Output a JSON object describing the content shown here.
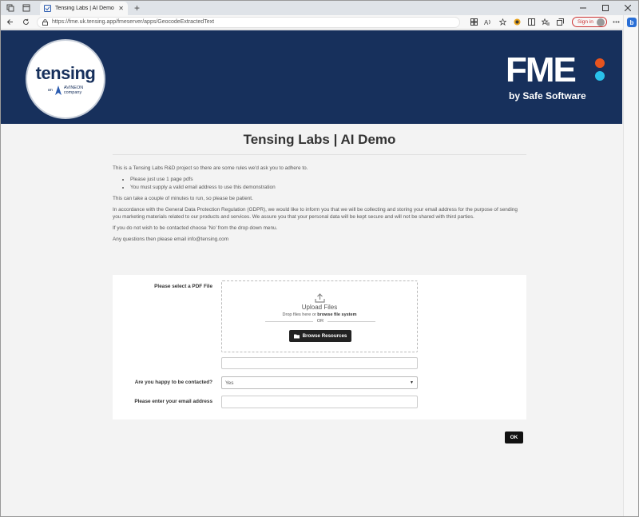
{
  "browser": {
    "tab_title": "Tensing Labs | AI Demo",
    "url": "https://fme.uk.tensing.app/fmeserver/apps/GeocodeExtractedText",
    "signin_label": "Sign in",
    "new_tab": "+",
    "close_tab": "✕"
  },
  "banner": {
    "logo_word": "tensing",
    "logo_an": "an",
    "logo_company_name": "AVINEON",
    "logo_company": "company",
    "fme_word": "FME",
    "fme_by": "by Safe Software"
  },
  "page": {
    "title": "Tensing Labs | AI Demo",
    "intro_1": "This is a Tensing Labs R&D project so there are some rules we'd ask you to adhere to.",
    "rules": [
      "Please just use 1 page pdfs",
      "You must supply a valid email address to use this demonstration"
    ],
    "intro_2": "This can take a couple of minutes to run, so please be patient.",
    "gdpr": "In accordance with the General Data Protection Regulation (GDPR), we would like to inform you that we will be collecting and storing your email address for the purpose of sending you marketing materials related to our products and services. We assure you that your personal data will be kept secure and will not be shared with third parties.",
    "optout": "If you do not wish to be contacted choose 'No' from the drop down menu.",
    "questions": "Any questions then please email info@tensing.com"
  },
  "form": {
    "pdf_label": "Please select a PDF File",
    "upload_title": "Upload Files",
    "drop_text": "Drop files here or",
    "browse_fs": "browse file system",
    "or_text": "OR",
    "browse_resources": "Browse Resources",
    "contact_label": "Are you happy to be contacted?",
    "contact_value": "Yes",
    "email_label": "Please enter your email address",
    "ok_label": "OK"
  }
}
